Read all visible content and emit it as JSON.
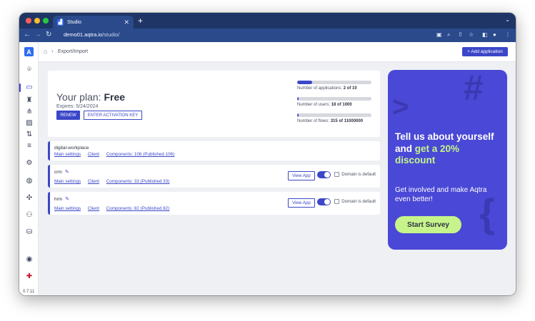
{
  "browser": {
    "tab_title": "Studio",
    "tab_close": "✕",
    "new_tab": "+",
    "url_host": "demo01.aqtra.io",
    "url_path": "/studio/"
  },
  "sidebar": {
    "version": "0.7.11",
    "icons": [
      "logo-icon",
      "scan-icon",
      "book-icon",
      "trophy-icon",
      "hierarchy-icon",
      "image-icon",
      "sort-icon",
      "list-icon",
      "gear-icon",
      "globe-icon",
      "puzzle-icon",
      "user-settings-icon",
      "database-icon",
      "account-icon",
      "uk-flag-icon"
    ]
  },
  "header": {
    "breadcrumb": "Export/Import",
    "add_application": "+ Add application"
  },
  "plan": {
    "label": "Your plan: ",
    "name": "Free",
    "expires": "Expires: 5/24/2024",
    "renew": "RENEW",
    "activation": "ENTER ACTIVATION KEY",
    "usage": [
      {
        "label": "Number of applications: ",
        "value": "2 of 10",
        "fraction": 0.2
      },
      {
        "label": "Number of users: ",
        "value": "18 of 1000",
        "fraction": 0.018
      },
      {
        "label": "Number of flows: ",
        "value": "315 of 11000000",
        "fraction": 3e-05
      }
    ]
  },
  "apps": [
    {
      "name": "digital-workplace",
      "main_settings": "Main settings",
      "client": "Client",
      "components": "Components: 106 (Published 106)"
    },
    {
      "name": "crm",
      "main_settings": "Main settings",
      "client": "Client",
      "components": "Components: 33 (Published 33)",
      "view_app": "View App",
      "domain_default": "Domain is default"
    },
    {
      "name": "hrm",
      "main_settings": "Main settings",
      "client": "Client",
      "components": "Components: 82 (Published 82)",
      "view_app": "View App",
      "domain_default": "Domain is default"
    }
  ],
  "promo": {
    "title_1": "Tell us about yourself and ",
    "title_highlight": "get a 20% discount",
    "subtitle": "Get involved and make Aqtra even better!",
    "cta": "Start Survey",
    "deco_hash": "#",
    "deco_caret": ">",
    "deco_brace": "{"
  },
  "colors": {
    "accent": "#3b47c8",
    "promo_bg": "#4a48d6",
    "promo_highlight": "#c6f48b",
    "browser_chrome": "#1f3566"
  }
}
